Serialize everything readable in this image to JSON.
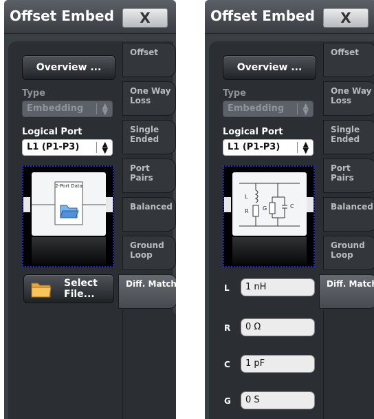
{
  "panels": [
    {
      "title": "Offset Embed",
      "close_label": "X",
      "overview_label": "Overview ...",
      "type_label": "Type",
      "type_value": "Embedding",
      "logical_port_label": "Logical Port",
      "logical_port_value": "L1 (P1-P3)",
      "diagram": {
        "title": "2-Port Data"
      },
      "select_file_label": "Select File...",
      "tabs": [
        "Offset",
        "One Way Loss",
        "Single Ended",
        "Port Pairs",
        "Balanced",
        "Ground Loop",
        "Diff. Match"
      ],
      "active_tab": "Diff. Match"
    },
    {
      "title": "Offset Embed",
      "close_label": "X",
      "overview_label": "Overview ...",
      "type_label": "Type",
      "type_value": "Embedding",
      "logical_port_label": "Logical Port",
      "logical_port_value": "L1 (P1-P3)",
      "diagram": {
        "labels": {
          "L": "L",
          "R": "R",
          "G": "G",
          "C": "C"
        }
      },
      "params": [
        {
          "name": "L",
          "value": "1 nH"
        },
        {
          "name": "R",
          "value": "0 Ω"
        },
        {
          "name": "C",
          "value": "1 pF"
        },
        {
          "name": "G",
          "value": "0 S"
        }
      ],
      "tabs": [
        "Offset",
        "One Way Loss",
        "Single Ended",
        "Port Pairs",
        "Balanced",
        "Ground Loop",
        "Diff. Match"
      ],
      "active_tab": "Diff. Match"
    }
  ],
  "colors": {
    "panel": "#3a3f44",
    "selection_border": "#1d2bd9"
  }
}
